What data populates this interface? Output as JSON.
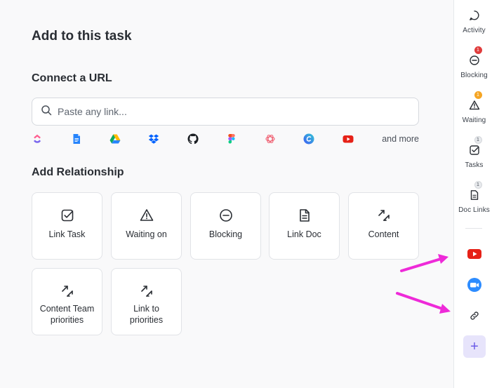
{
  "page": {
    "title": "Add to this task"
  },
  "connect_url": {
    "heading": "Connect a URL",
    "input_placeholder": "Paste any link...",
    "input_value": "",
    "integrations": [
      "clickup-icon",
      "google-docs-icon",
      "google-drive-icon",
      "dropbox-icon",
      "github-icon",
      "figma-icon",
      "openai-icon",
      "canva-icon",
      "youtube-icon"
    ],
    "and_more": "and more"
  },
  "relationships": {
    "heading": "Add Relationship",
    "cards": [
      {
        "label": "Link Task",
        "icon": "checkbox-icon"
      },
      {
        "label": "Waiting on",
        "icon": "warning-icon"
      },
      {
        "label": "Blocking",
        "icon": "minus-circle-icon"
      },
      {
        "label": "Link Doc",
        "icon": "document-icon"
      },
      {
        "label": "Content",
        "icon": "arrows-icon"
      },
      {
        "label": "Content Team priorities",
        "icon": "arrows-icon"
      },
      {
        "label": "Link to priorities",
        "icon": "arrows-icon"
      }
    ]
  },
  "sidebar": {
    "items": [
      {
        "label": "Activity",
        "icon": "chat-icon",
        "badge": ""
      },
      {
        "label": "Blocking",
        "icon": "minus-circle-icon",
        "badge": "1",
        "badge_color": "#e03c3c"
      },
      {
        "label": "Waiting",
        "icon": "warning-icon",
        "badge": "1",
        "badge_color": "#f5a524"
      },
      {
        "label": "Tasks",
        "icon": "checkbox-icon",
        "badge": "1"
      },
      {
        "label": "Doc Links",
        "icon": "document-icon",
        "badge": "1"
      }
    ],
    "apps": [
      "youtube-icon",
      "zoom-icon",
      "link-icon"
    ],
    "add_label": "+"
  },
  "colors": {
    "accent": "#6b5ce7",
    "annotation_arrow": "#ee2ad8",
    "youtube": "#e62117",
    "zoom": "#2d8cff"
  }
}
